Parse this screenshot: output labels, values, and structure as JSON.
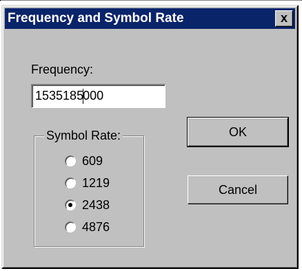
{
  "window": {
    "title": "Frequency and Symbol Rate",
    "close_glyph": "x"
  },
  "frequency": {
    "label": "Frequency:",
    "value_before_caret": "1535185",
    "value_after_caret": "000"
  },
  "symbol_rate": {
    "legend": "Symbol Rate:",
    "options": [
      {
        "label": "609",
        "checked": false
      },
      {
        "label": "1219",
        "checked": false
      },
      {
        "label": "2438",
        "checked": true
      },
      {
        "label": "4876",
        "checked": false
      }
    ]
  },
  "buttons": {
    "ok_label": "OK",
    "cancel_label": "Cancel"
  },
  "colors": {
    "titlebar": "#0a246a",
    "dialog_face": "#c0c0c0"
  }
}
